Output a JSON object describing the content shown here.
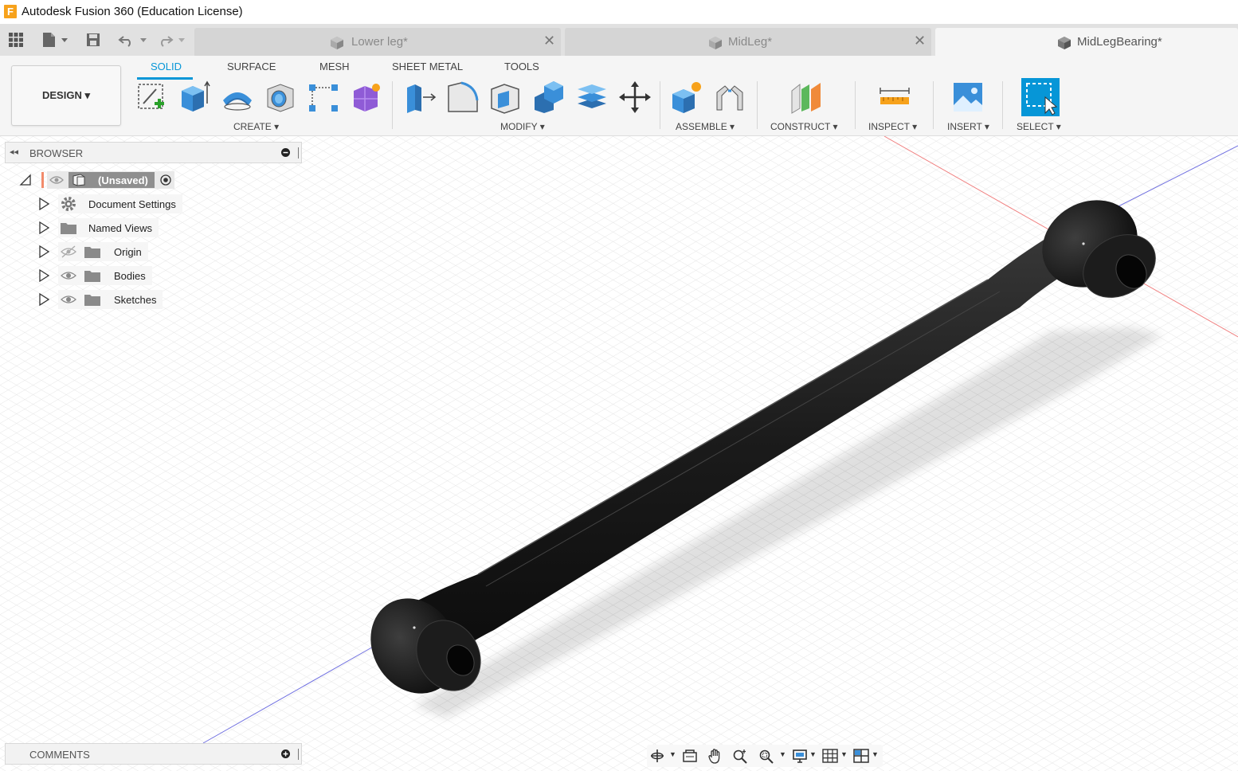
{
  "app": {
    "title": "Autodesk Fusion 360 (Education License)",
    "logo_letter": "F"
  },
  "tabs": [
    {
      "label": "Lower leg*",
      "active": false,
      "close": "✕"
    },
    {
      "label": "MidLeg*",
      "active": false,
      "close": "✕"
    },
    {
      "label": "MidLegBearing*",
      "active": true
    }
  ],
  "toolbar": {
    "workspace_button": "DESIGN ▾",
    "workspace_tabs": [
      "SOLID",
      "SURFACE",
      "MESH",
      "SHEET METAL",
      "TOOLS"
    ],
    "active_tab": "SOLID",
    "groups": {
      "create": "CREATE ▾",
      "modify": "MODIFY ▾",
      "assemble": "ASSEMBLE ▾",
      "construct": "CONSTRUCT ▾",
      "inspect": "INSPECT ▾",
      "insert": "INSERT ▾",
      "select": "SELECT ▾"
    },
    "accent": "#0696d7"
  },
  "browser": {
    "title": "BROWSER",
    "root": "(Unsaved)",
    "items": [
      "Document Settings",
      "Named Views",
      "Origin",
      "Bodies",
      "Sketches"
    ]
  },
  "comments": {
    "title": "COMMENTS"
  },
  "viewport": {
    "model_color": "#1a1a1a",
    "grid_color": "#e3e3e3"
  }
}
